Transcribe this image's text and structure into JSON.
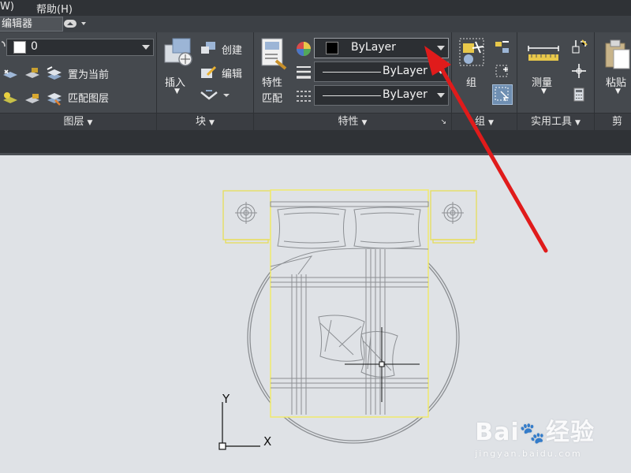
{
  "menubar": {
    "window_fragment": "W)",
    "help": "帮助(H)"
  },
  "tabs": {
    "active": "编辑器"
  },
  "layers": {
    "current_layer": "0",
    "make_current": "置为当前",
    "match_layer": "匹配图层",
    "label": "图层"
  },
  "block": {
    "insert": "插入",
    "create": "创建",
    "edit": "编辑",
    "label": "块"
  },
  "properties": {
    "match_line1": "特性",
    "match_line2": "匹配",
    "color_value": "ByLayer",
    "linetype_value": "ByLayer",
    "lineweight_value": "ByLayer",
    "label": "特性",
    "color_swatch": "#000000"
  },
  "groups": {
    "group_button": "组",
    "label": "组"
  },
  "utilities": {
    "measure": "测量",
    "label": "实用工具"
  },
  "clipboard": {
    "paste": "粘贴",
    "label": "剪贴"
  },
  "canvas": {
    "ucs_y": "Y",
    "ucs_x": "X",
    "bg_color": "#dfe2e6",
    "highlight_color": "#f0e96b",
    "annotation_arrow_color": "#e01b1b"
  },
  "watermark": {
    "brand": "Bai",
    "brand_cn": "经验",
    "url": "jingyan.baidu.com"
  }
}
